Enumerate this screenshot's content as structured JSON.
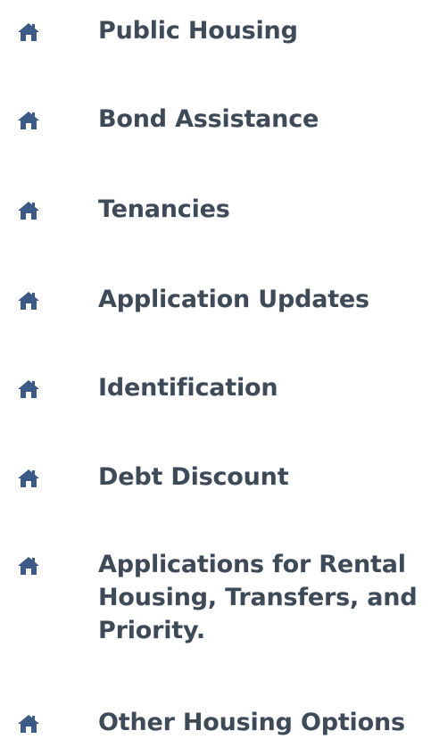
{
  "menu": {
    "icon": "home-icon",
    "icon_color": "#3b5b86",
    "text_color": "#3f4a58",
    "items": [
      {
        "label": "Public Housing"
      },
      {
        "label": "Bond Assistance"
      },
      {
        "label": "Tenancies"
      },
      {
        "label": "Application Updates"
      },
      {
        "label": "Identification"
      },
      {
        "label": "Debt Discount"
      },
      {
        "label": "Applications for Rental Housing, Transfers, and Priority."
      },
      {
        "label": "Other Housing Options"
      }
    ]
  }
}
